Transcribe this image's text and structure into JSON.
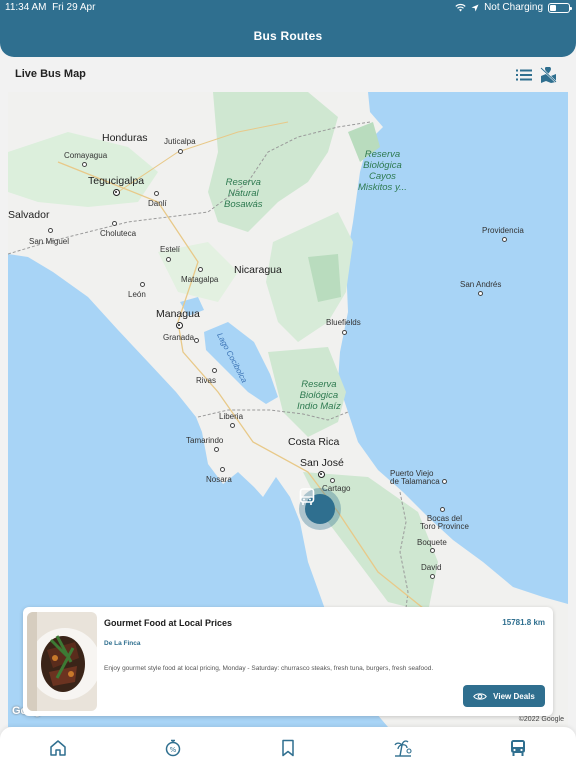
{
  "status_bar": {
    "time": "11:34 AM",
    "date": "Fri 29 Apr",
    "charging": "Not Charging"
  },
  "header": {
    "title": "Bus Routes"
  },
  "section": {
    "title": "Live Bus Map",
    "icons": [
      "list-icon",
      "map-toggle-icon"
    ]
  },
  "map": {
    "labels": {
      "honduras": "Honduras",
      "juticalpa": "Juticalpa",
      "comayagua": "Comayagua",
      "tegucigalpa": "Tegucigalpa",
      "danli": "Danlí",
      "salvador": "Salvador",
      "choluteca": "Choluteca",
      "san_miguel": "San Miguel",
      "esteli": "Estelí",
      "matagalpa": "Matagalpa",
      "nicaragua": "Nicaragua",
      "leon": "León",
      "managua": "Managua",
      "granada": "Granada",
      "lake": "Lago Cocibolca",
      "rivas": "Rivas",
      "bluefields": "Bluefields",
      "liberia": "Liberia",
      "tamarindo": "Tamarindo",
      "nosara": "Nosara",
      "costa_rica": "Costa Rica",
      "san_jose": "San José",
      "cartago": "Cartago",
      "puerto_viejo": "Puerto Viejo\nde Talamanca",
      "bocas": "Bocas del\nToro Province",
      "boquete": "Boquete",
      "david": "David",
      "providencia": "Providencia",
      "san_andres": "San Andrés",
      "reserve_bosawas": "Reserva\nNatural\nBosawás",
      "reserve_miskitos": "Reserva\nBiológica\nCayos\nMiskitos y...",
      "reserve_indio": "Reserva\nBiológica\nIndio Maíz"
    },
    "google": "Google",
    "copyright": "©2022 Google",
    "marker_icon": "bus-icon"
  },
  "deal_card": {
    "title": "Gourmet Food at Local Prices",
    "distance": "15781.8 km",
    "vendor": "De La Finca",
    "description": "Enjoy gourmet style food at local pricing, Monday - Saturday: churrasco steaks, fresh tuna, burgers, fresh seafood.",
    "button_label": "View Deals",
    "button_icon": "eye-icon"
  },
  "tabbar": {
    "tabs": [
      "home-icon",
      "discount-icon",
      "bookmark-icon",
      "beach-icon",
      "bus-icon"
    ],
    "active_tab": "bus-icon"
  },
  "colors": {
    "primary": "#2f6f8f",
    "water": "#a8d4f6",
    "land": "#f1f1ef",
    "forest": "#cfe7d1"
  }
}
